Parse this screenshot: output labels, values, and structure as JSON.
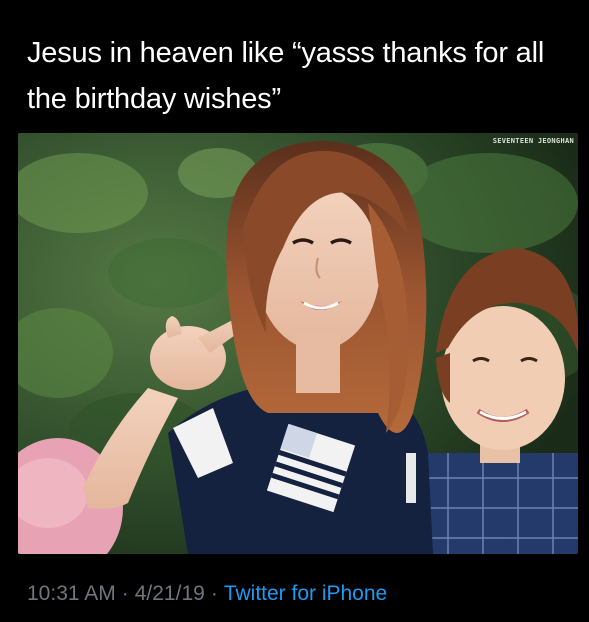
{
  "tweet": {
    "text": "Jesus in heaven like “yasss thanks for all the birthday wishes”",
    "media": {
      "watermark": "SEVENTEEN JEONGHAN"
    },
    "time": "10:31 AM",
    "separator": "·",
    "date": "4/21/19",
    "source": "Twitter for iPhone"
  },
  "colors": {
    "background": "#000000",
    "text": "#ffffff",
    "meta": "#6e767d",
    "link": "#1d9bf0"
  }
}
